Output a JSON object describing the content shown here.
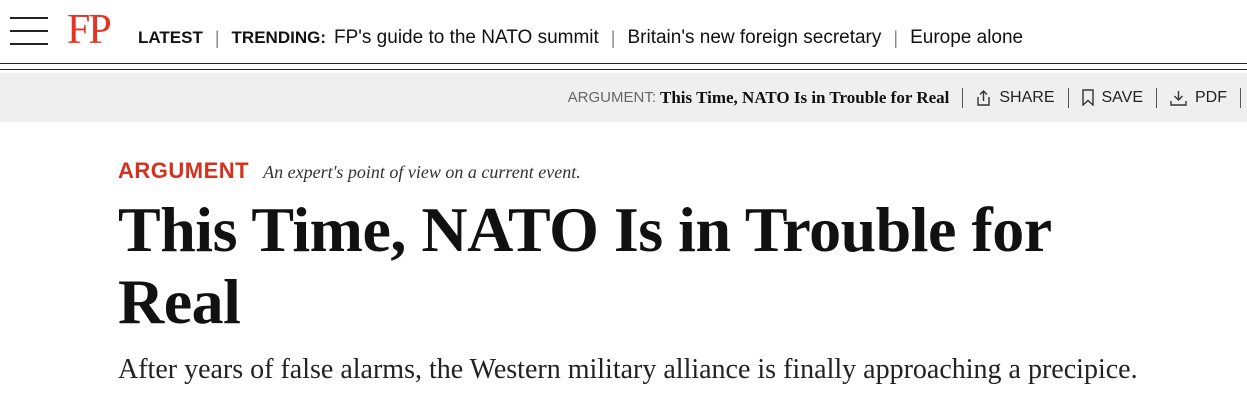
{
  "logo": "FP",
  "nav": {
    "latest": "LATEST",
    "trending_label": "TRENDING:",
    "trending": [
      "FP's guide to the NATO summit",
      "Britain's new foreign secretary",
      "Europe alone"
    ]
  },
  "subbar": {
    "kicker": "ARGUMENT:",
    "title": "This Time, NATO Is in Trouble for Real",
    "share": "SHARE",
    "save": "SAVE",
    "pdf": "PDF"
  },
  "article": {
    "section": "ARGUMENT",
    "tagline": "An expert's point of view on a current event.",
    "headline": "This Time, NATO Is in Trouble for Real",
    "dek": "After years of false alarms, the Western military alliance is finally approaching a precipice."
  },
  "colors": {
    "brand_red": "#e63323",
    "section_red": "#d6311f",
    "subbar_bg": "#f0efef"
  },
  "icons": [
    "menu-icon",
    "share-icon",
    "bookmark-icon",
    "download-icon"
  ]
}
